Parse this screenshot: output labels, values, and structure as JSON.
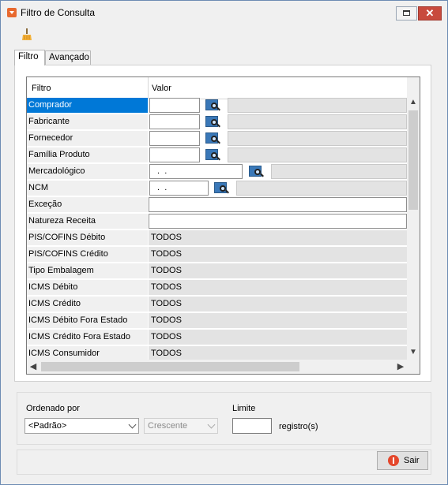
{
  "window": {
    "title": "Filtro de Consulta",
    "close_symbol": "✕"
  },
  "tabs": [
    {
      "label": "Filtro"
    },
    {
      "label": "Avançado"
    }
  ],
  "grid": {
    "headers": {
      "filtro": "Filtro",
      "valor": "Valor"
    },
    "rows": [
      {
        "label": "Comprador",
        "value": ""
      },
      {
        "label": "Fabricante",
        "value": ""
      },
      {
        "label": "Fornecedor",
        "value": ""
      },
      {
        "label": "Família Produto",
        "value": ""
      },
      {
        "label": "Mercadológico",
        "value": " .  ."
      },
      {
        "label": "NCM",
        "value": " .  ."
      },
      {
        "label": "Exceção",
        "value": ""
      },
      {
        "label": "Natureza Receita",
        "value": ""
      },
      {
        "label": "PIS/COFINS Débito",
        "value": "TODOS"
      },
      {
        "label": "PIS/COFINS Crédito",
        "value": "TODOS"
      },
      {
        "label": "Tipo Embalagem",
        "value": "TODOS"
      },
      {
        "label": "ICMS Débito",
        "value": "TODOS"
      },
      {
        "label": "ICMS Crédito",
        "value": "TODOS"
      },
      {
        "label": "ICMS Débito Fora Estado",
        "value": "TODOS"
      },
      {
        "label": "ICMS Crédito Fora Estado",
        "value": "TODOS"
      },
      {
        "label": "ICMS Consumidor",
        "value": "TODOS"
      }
    ]
  },
  "order": {
    "label": "Ordenado por",
    "field_value": "<Padrão>",
    "direction_value": "Crescente",
    "limit_label": "Limite",
    "limit_value": "",
    "limit_unit": "registro(s)"
  },
  "footer": {
    "exit_label": "Sair"
  },
  "icons": {
    "app": "app-menu-icon",
    "clear": "broom-icon",
    "lookup": "lookup-search-icon",
    "exit": "exit-icon"
  },
  "colors": {
    "selection": "#0078d7",
    "close_button": "#c84a3d",
    "exit_icon": "#e4462b"
  }
}
